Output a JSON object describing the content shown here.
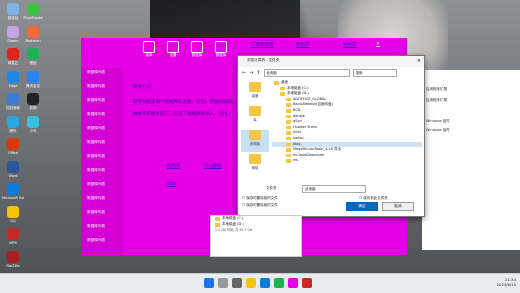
{
  "desktop": {
    "icons": [
      {
        "label": "回收站",
        "color": "#7fb2e5"
      },
      {
        "label": "Steam",
        "color": "#c8a2e5"
      },
      {
        "label": "网易云",
        "color": "#e0241a"
      },
      {
        "label": "Edge",
        "color": "#1e88e5"
      },
      {
        "label": "控制面板",
        "color": "#3a7bd5"
      },
      {
        "label": "腾讯",
        "color": "#2aa6e0"
      },
      {
        "label": "Office",
        "color": "#d83b01"
      },
      {
        "label": "Word",
        "color": "#2b579a"
      },
      {
        "label": "Microsoft Edge",
        "color": "#0f7bd9"
      },
      {
        "label": "QQ",
        "color": "#f5c400"
      },
      {
        "label": "WPS",
        "color": "#c62828"
      },
      {
        "label": "FileZilla",
        "color": "#a82020"
      },
      {
        "label": "BlueStacks",
        "color": "#3ec33e"
      },
      {
        "label": "Postman",
        "color": "#f26b3a"
      },
      {
        "label": "微信",
        "color": "#1bb353"
      },
      {
        "label": "腾讯会议",
        "color": "#2b83f6"
      },
      {
        "label": "剪映",
        "color": "#222222"
      },
      {
        "label": "小鸟",
        "color": "#3cc0e0"
      }
    ]
  },
  "app": {
    "sidebar_items": [
      "·数据库列表",
      "·数据库列表",
      "·数据库列表",
      "·数据库列表",
      "·数据库列表",
      "·数据库列表",
      "·数据库列表",
      "·数据库列表",
      "·数据库列表",
      "·数据库列表",
      "·数据库列表",
      "·数据库列表",
      "·数据库列表"
    ],
    "toolbar": [
      "菜单",
      "设置",
      "数据库",
      "数据库"
    ],
    "links": [
      "下载数据库",
      "数据库",
      "数据库",
      "数据库"
    ],
    "heading": "软件介绍",
    "body1": "软件功能是用于数据库的查看、导出、管理数据库。",
    "body2": "数据库的相关操作，包括了数据库的导入、导出。",
    "bottom_links": [
      "数据库",
      "导出数据",
      "帮助"
    ]
  },
  "dialog": {
    "title": "浏览计算机 - 文件夹",
    "path": "此电脑",
    "search_placeholder": "搜索",
    "places": [
      "桌面",
      "库",
      "此电脑",
      "网络"
    ],
    "tree": [
      {
        "label": "桌面",
        "indent": 0
      },
      {
        "label": "本地磁盘 (C:)",
        "indent": 1
      },
      {
        "label": "本地磁盘 (D:)",
        "indent": 1
      },
      {
        "label": "ADOFFICE_GLOBAL",
        "indent": 2
      },
      {
        "label": "BaiduNetdisk(百度网盘)",
        "indent": 2
      },
      {
        "label": "BCD",
        "indent": 2
      },
      {
        "label": "dongle",
        "indent": 2
      },
      {
        "label": "gSyn",
        "indent": 2
      },
      {
        "label": "Huawei Share",
        "indent": 2
      },
      {
        "label": "Intel",
        "indent": 2
      },
      {
        "label": "kaifan",
        "indent": 2
      },
      {
        "label": "ktao",
        "indent": 2
      },
      {
        "label": "MegaMinuteToolk_4.16 导出",
        "indent": 2
      },
      {
        "label": "mCloudDownload",
        "indent": 2
      },
      {
        "label": "ms",
        "indent": 2
      }
    ],
    "folder_label": "文件夹",
    "folder_value": "此电脑",
    "checkbox1": "保存时删除临时文件",
    "checkbox2": "保存时删除临时文件",
    "checkbox3": "保存到此文件夹",
    "ok": "确定",
    "cancel": "取消",
    "size_text": "2.0 GB 可用, 共 95.7 GB"
  },
  "explorer": {
    "items": [
      "应用程序扩展",
      "应用程序扩展",
      "Windows 组件",
      "Windows 组件"
    ]
  },
  "taskbar": {
    "time": "21:34",
    "date": "2023/6/10"
  }
}
